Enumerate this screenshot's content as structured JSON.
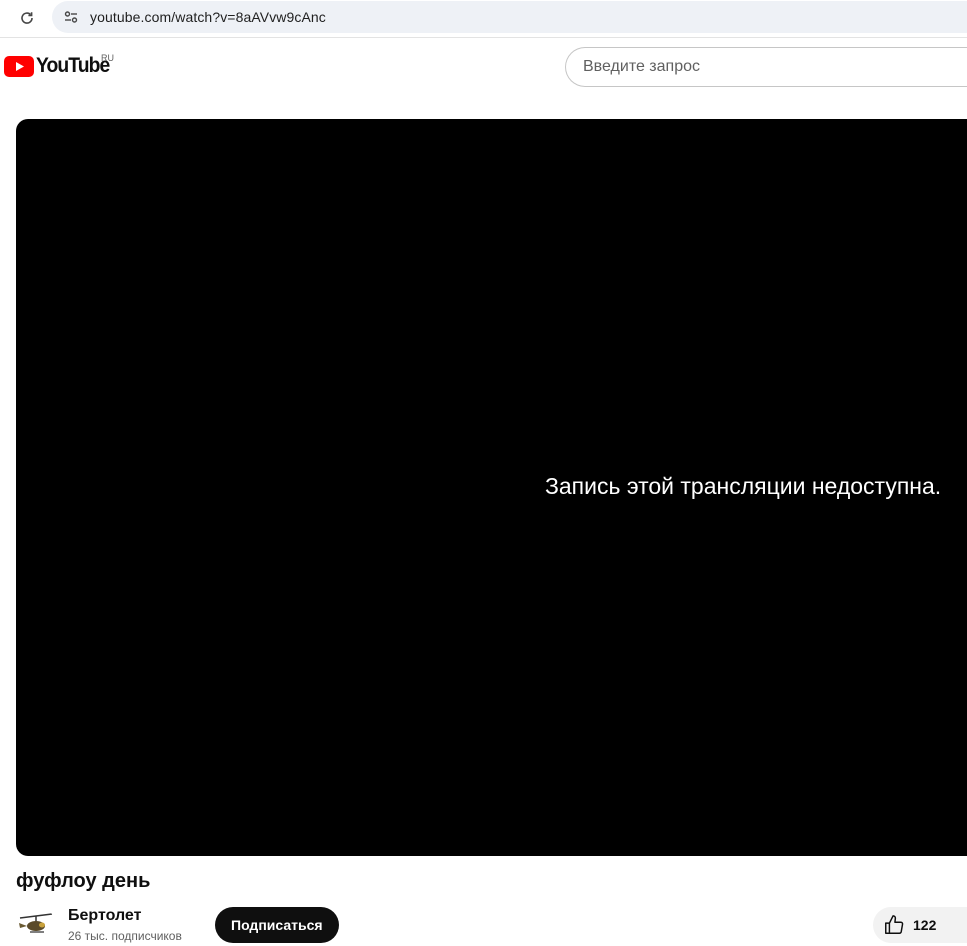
{
  "browser": {
    "url": "youtube.com/watch?v=8aAVvw9cAnc"
  },
  "header": {
    "logo_text": "YouTube",
    "region": "RU",
    "search_placeholder": "Введите запрос"
  },
  "player": {
    "message": "Запись этой трансляции недоступна."
  },
  "video": {
    "title": "фуфлоу день",
    "channel_name": "Бертолет",
    "subscribers": "26 тыс. подписчиков",
    "subscribe_label": "Подписаться",
    "like_count": "122"
  },
  "colors": {
    "brand_red": "#ff0000",
    "player_bg": "#000000",
    "subscribe_bg": "#0f0f0f"
  }
}
